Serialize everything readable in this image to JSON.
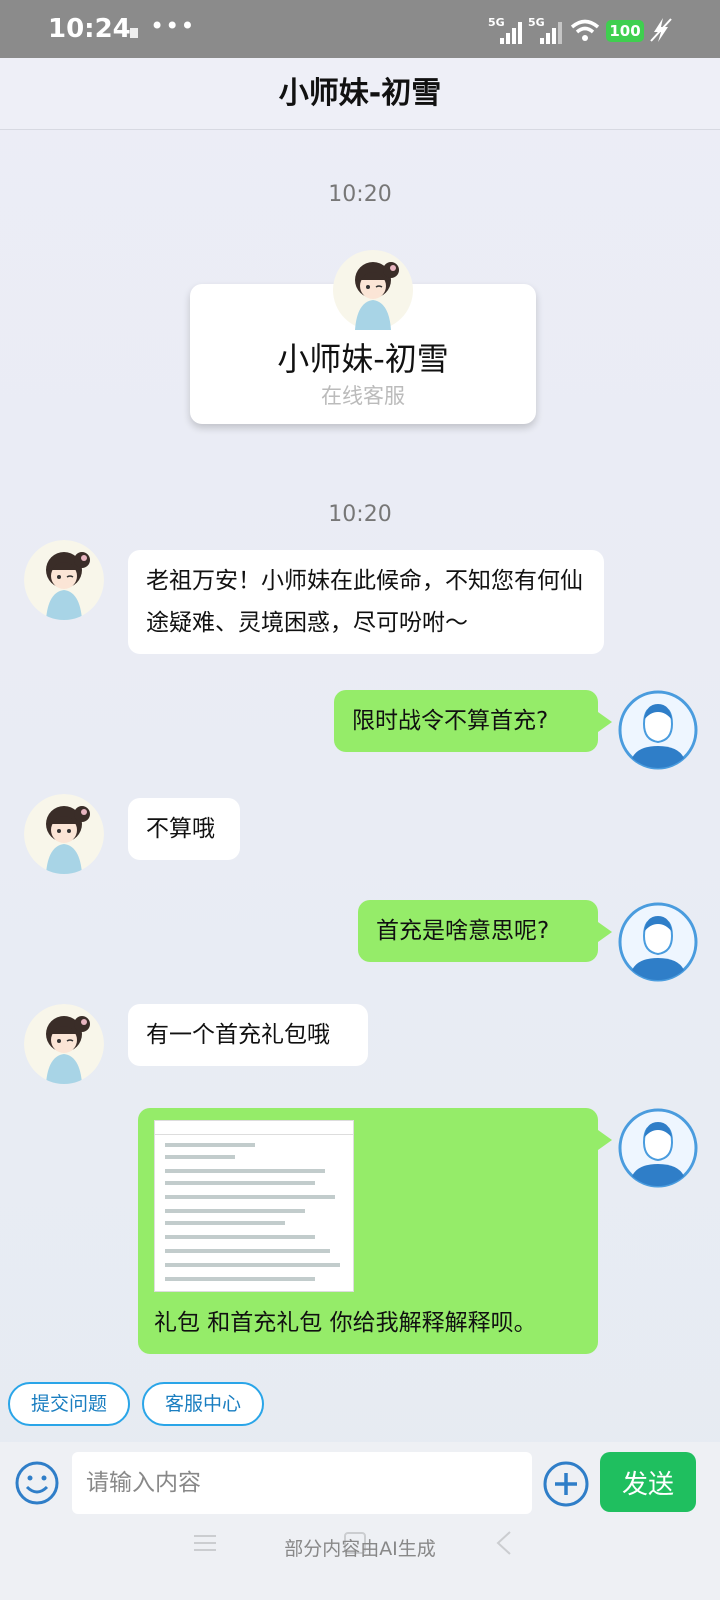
{
  "status_bar": {
    "time": "10:24",
    "more": "•••",
    "signal1": "5G",
    "signal2": "5G",
    "battery": "100"
  },
  "header": {
    "title": "小师妹-初雪"
  },
  "profile_card": {
    "timestamp": "10:20",
    "name": "小师妹-初雪",
    "subtitle": "在线客服"
  },
  "conversation_timestamp": "10:20",
  "messages": [
    {
      "side": "left",
      "text": "老祖万安！小师妹在此候命，不知您有何仙途疑难、灵境困惑，尽可吩咐～"
    },
    {
      "side": "right",
      "text": "限时战令不算首充?"
    },
    {
      "side": "left",
      "text": "不算哦"
    },
    {
      "side": "right",
      "text": "首充是啥意思呢?"
    },
    {
      "side": "left",
      "text": "有一个首充礼包哦"
    },
    {
      "side": "right",
      "text": "礼包 和首充礼包 你给我解释解释呗。",
      "has_image": true
    }
  ],
  "quick_actions": [
    "提交问题",
    "客服中心"
  ],
  "input": {
    "placeholder": "请输入内容",
    "value": ""
  },
  "send_label": "发送",
  "footer_note": "部分内容由AI生成",
  "colors": {
    "user_bubble": "#95ec69",
    "send_button": "#1fbf5f",
    "chip_border": "#2aa5e8"
  }
}
